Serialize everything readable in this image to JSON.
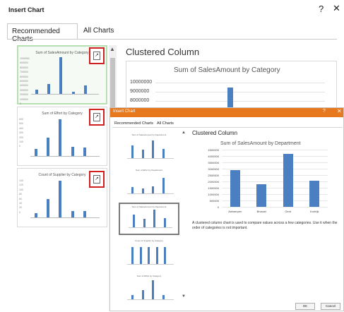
{
  "back_dialog": {
    "title": "Insert Chart",
    "help_glyph": "?",
    "close_glyph": "✕",
    "tabs": [
      {
        "label": "Recommended Charts"
      },
      {
        "label": "All Charts"
      }
    ],
    "thumbnails": [
      {
        "title": "Sum of SalesAmount by Category",
        "values": [
          10,
          25,
          90,
          5,
          20
        ],
        "selected": true,
        "yticks": [
          "1000000",
          "900000",
          "800000",
          "700000",
          "600000",
          "500000",
          "400000",
          "300000",
          "200000",
          "100000",
          "0"
        ]
      },
      {
        "title": "Sum of Effort by Category",
        "values": [
          18,
          45,
          90,
          22,
          20
        ],
        "selected": false,
        "yticks": [
          "600",
          "500",
          "400",
          "300",
          "200",
          "100",
          "0"
        ]
      },
      {
        "title": "Count of Supplier by Category",
        "values": [
          10,
          45,
          90,
          15,
          15
        ],
        "selected": false,
        "yticks": [
          "140",
          "120",
          "100",
          "80",
          "60",
          "40",
          "20",
          "0"
        ]
      }
    ],
    "main_title": "Clustered Column",
    "chart_title": "Sum of SalesAmount by Category",
    "yticks": [
      "10000000",
      "9000000",
      "8000000"
    ]
  },
  "front_dialog": {
    "title": "Insert Chart",
    "help_glyph": "?",
    "close_glyph": "✕",
    "tabs": [
      {
        "label": "Recommended Charts"
      },
      {
        "label": "All Charts"
      }
    ],
    "main_title": "Clustered Column",
    "description": "A clustered column chart is used to compare values across a few categories. Use it when the order of categories is not important.",
    "ok_label": "OK",
    "cancel_label": "Cancel",
    "thumbnails": [
      {
        "title": "Sum of SalesAmount by Department",
        "values": [
          60,
          40,
          85,
          45
        ],
        "selected": false
      },
      {
        "title": "Sum of Effort by Department",
        "values": [
          30,
          25,
          35,
          75
        ],
        "selected": false
      },
      {
        "title": "Sum of SalesAmount by Department",
        "values": [
          60,
          40,
          85,
          45
        ],
        "selected": true
      },
      {
        "title": "Count of Supplier by Category",
        "values": [
          80,
          80,
          80,
          80,
          80
        ],
        "selected": false
      },
      {
        "title": "Sum of Effort by Category",
        "values": [
          20,
          45,
          90,
          20
        ],
        "selected": false
      }
    ]
  },
  "chart_data": {
    "type": "bar",
    "title": "Sum of SalesAmount by Department",
    "categories": [
      "Antwerpen",
      "Brussel",
      "Gent",
      "Kortrijk"
    ],
    "values": [
      2900000,
      1800000,
      4150000,
      2050000
    ],
    "yticks": [
      "4500000",
      "4000000",
      "3500000",
      "3000000",
      "2500000",
      "2000000",
      "1500000",
      "1000000",
      "500000",
      "0"
    ],
    "ylim": [
      0,
      4500000
    ],
    "bar_color": "#4a7fc1"
  },
  "colors": {
    "title_bar": "#e8781d",
    "highlight": "#d12020",
    "bar": "#4a7fc1"
  }
}
